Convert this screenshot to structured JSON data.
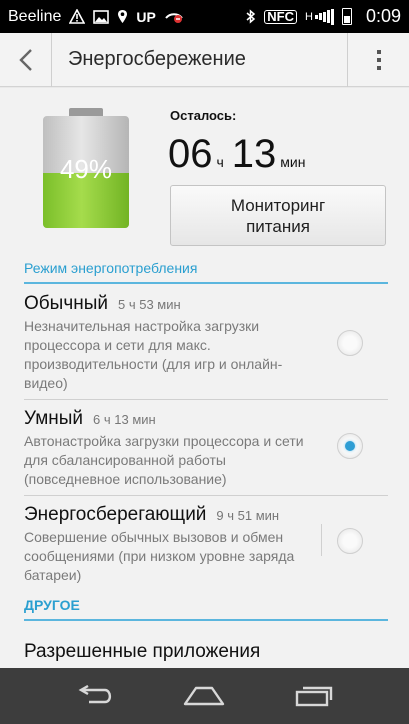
{
  "status_bar": {
    "carrier": "Beeline",
    "up_label": "UP",
    "nfc_label": "NFC",
    "network_label": "H",
    "time": "0:09"
  },
  "header": {
    "title": "Энергосбережение"
  },
  "battery": {
    "percent_text": "49%",
    "percent_value": 49,
    "remaining_label": "Осталось:",
    "hours": "06",
    "hours_unit": "ч",
    "minutes": "13",
    "minutes_unit": "мин",
    "monitor_button_line1": "Мониторинг",
    "monitor_button_line2": "питания"
  },
  "power_mode": {
    "section_title": "Режим энергопотребления",
    "modes": [
      {
        "name": "Обычный",
        "duration": "5 ч 53 мин",
        "description": "Незначительная настройка загрузки процессора и сети для макс. производительности (для игр и онлайн-видео)",
        "selected": false
      },
      {
        "name": "Умный",
        "duration": "6 ч 13 мин",
        "description": "Автонастройка загрузки процессора и сети для сбалансированной работы (повседневное использование)",
        "selected": true
      },
      {
        "name": "Энергосберегающий",
        "duration": "9 ч 51 мин",
        "description": "Совершение обычных вызовов и обмен сообщениями (при низком уровне заряда батареи)",
        "selected": false
      }
    ]
  },
  "other": {
    "section_title": "ДРУГОЕ",
    "items": [
      "Разрешенные приложения"
    ]
  },
  "colors": {
    "accent": "#2a9fd0",
    "battery_fill": "#8fcd3a"
  }
}
